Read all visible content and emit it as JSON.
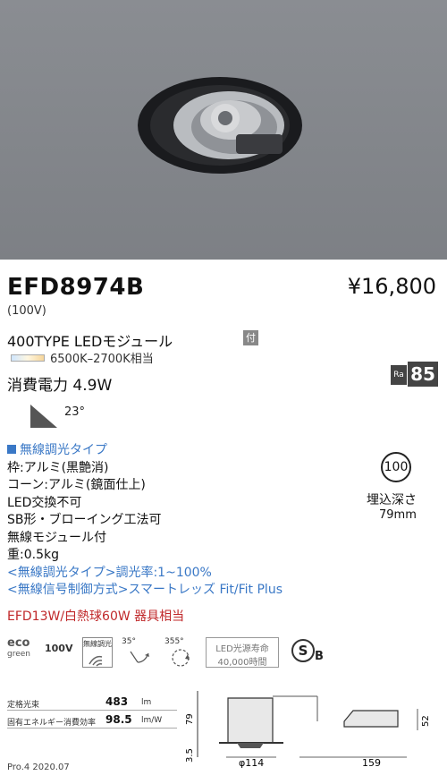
{
  "product": {
    "model": "EFD8974B",
    "price": "¥16,800",
    "voltage": "(100V)",
    "module": "400TYPE LEDモジュール",
    "module_badge": "付",
    "color_temp": "6500K–2700K相当",
    "power": "消費電力 4.9W",
    "ra_label": "Ra",
    "ra_value": "85",
    "beam_angle": "23°"
  },
  "specs": {
    "line1": "無線調光タイプ",
    "line2": "枠:アルミ(黒艶消)",
    "line3": "コーン:アルミ(鏡面仕上)",
    "line4": "LED交換不可",
    "line5": "SB形・ブローイング工法可",
    "line6": "無線モジュール付",
    "line7": "重:0.5kg",
    "line8": "<無線調光タイプ>調光率:1~100%",
    "line9": "<無線信号制御方式>スマートレッズ Fit/Fit Plus"
  },
  "depth": {
    "circle": "100",
    "label": "埋込深さ",
    "value": "79mm"
  },
  "equivalent": "EFD13W/白熱球60W 器具相当",
  "icons": {
    "eco_top": "eco",
    "eco_bottom": "green",
    "v100": "100V",
    "wireless": "無線調光",
    "tilt": "35°",
    "rotate": "355°",
    "life_top": "LED光源寿命",
    "life_bottom": "40,000時間",
    "sb_mark": "S",
    "sb_letter": "B"
  },
  "table": {
    "row1_label": "定格光束",
    "row1_value": "483",
    "row1_unit": "lm",
    "row2_label": "固有エネルギー消費効率",
    "row2_value": "98.5",
    "row2_unit": "lm/W"
  },
  "drawing": {
    "h79": "79",
    "h35": "3.5",
    "dia": "φ114",
    "len": "159",
    "h52": "52"
  },
  "footer": "Pro.4 2020.07",
  "colors": {
    "accent_blue": "#3a78c6",
    "equiv_red": "#c0282a",
    "badge_gray": "#444444"
  }
}
